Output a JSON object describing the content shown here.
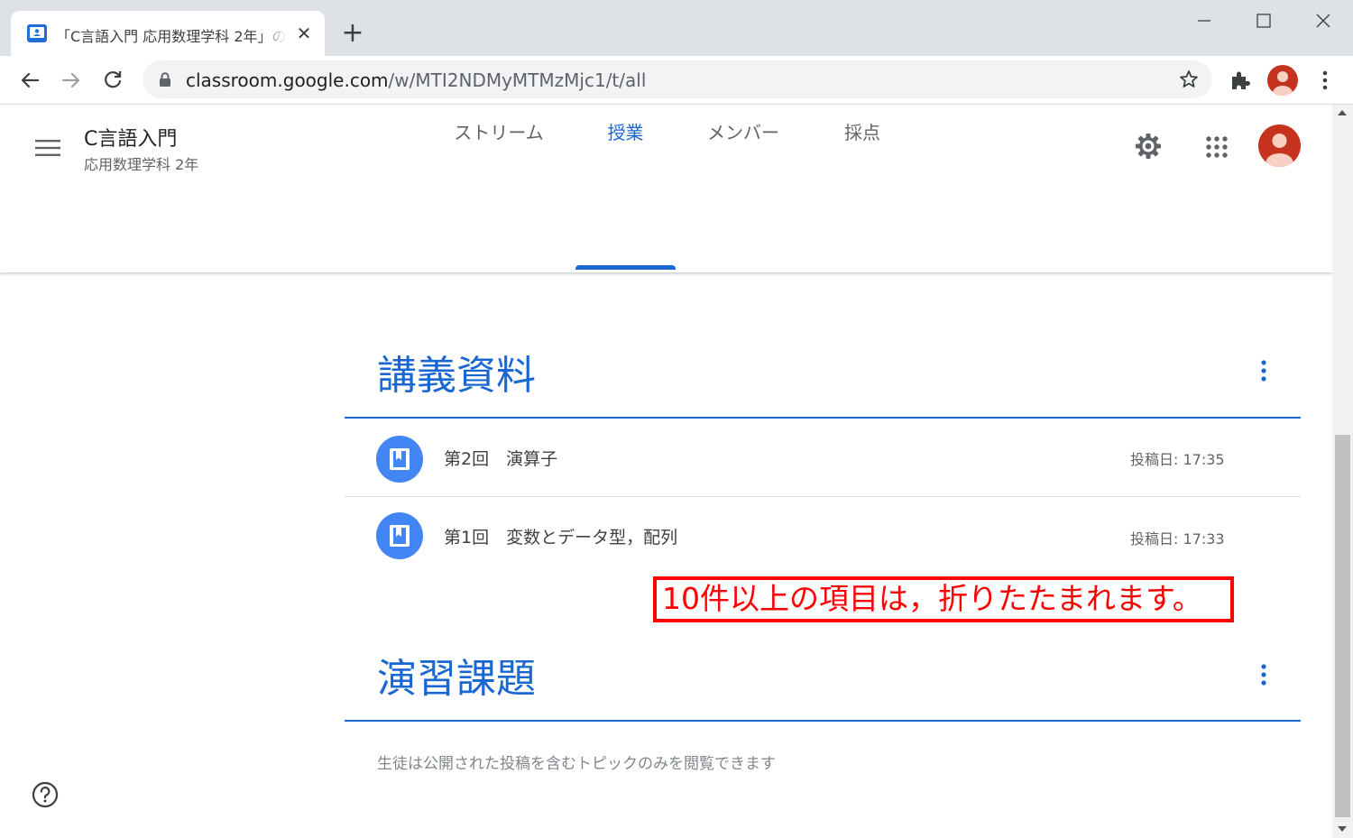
{
  "browser": {
    "tab_title": "「C言語入門 応用数理学科 2年」の",
    "tab_close": "✕",
    "new_tab": "+",
    "url_host": "classroom.google.com",
    "url_path": "/w/MTI2NDMyMTMzMjc1/t/all"
  },
  "header": {
    "course_title": "C言語入門",
    "course_subtitle": "応用数理学科 2年"
  },
  "tabs": [
    {
      "label": "ストリーム"
    },
    {
      "label": "授業"
    },
    {
      "label": "メンバー"
    },
    {
      "label": "採点"
    }
  ],
  "active_tab": "授業",
  "topics": [
    {
      "title": "講義資料",
      "materials": [
        {
          "title": "第2回　演算子",
          "date": "投稿日: 17:35"
        },
        {
          "title": "第1回　変数とデータ型，配列",
          "date": "投稿日: 17:33"
        }
      ]
    },
    {
      "title": "演習課題",
      "materials": []
    }
  ],
  "annotation": "10件以上の項目は，折りたたまれます。",
  "note": "生徒は公開された投稿を含むトピックのみを閲覧できます",
  "colors": {
    "accent": "#1967d2",
    "avatar": "#c5331f",
    "annotation": "#ff0000"
  },
  "icons": [
    "back-icon",
    "forward-icon",
    "reload-icon",
    "lock-icon",
    "star-icon",
    "extensions-icon",
    "menu-icon",
    "gear-icon",
    "apps-icon",
    "more-vert-icon",
    "book-icon",
    "help-icon"
  ]
}
